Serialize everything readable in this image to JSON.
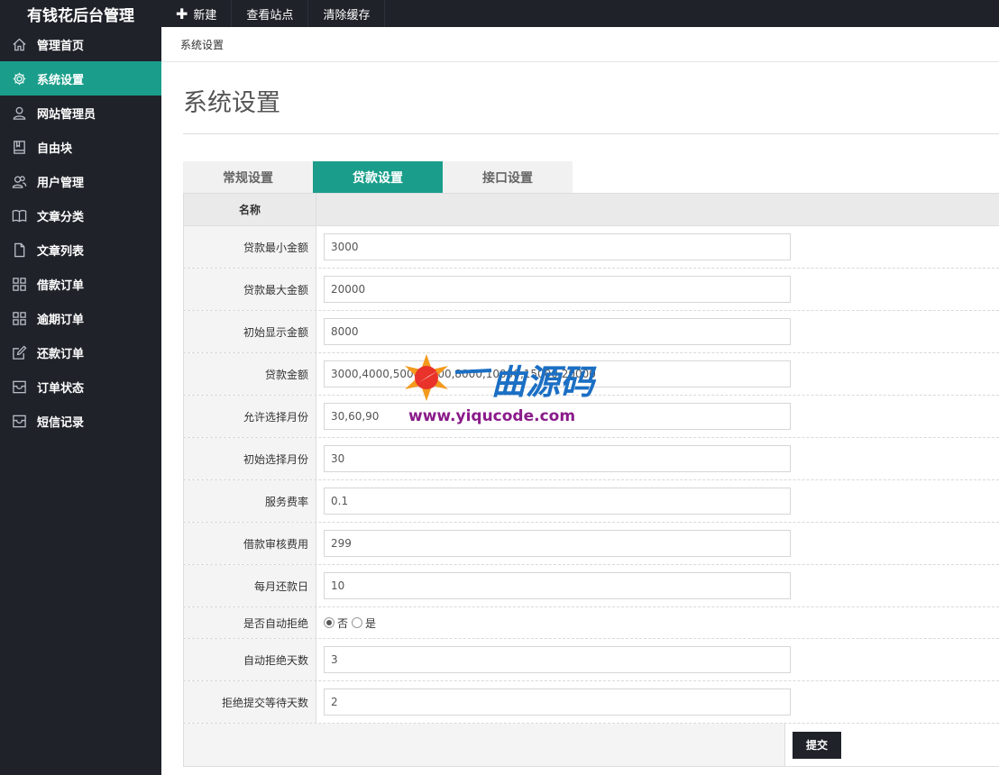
{
  "brand": {
    "title": "有钱花后台管理"
  },
  "topnav": {
    "new": "新建",
    "view_site": "查看站点",
    "clear_cache": "清除缓存"
  },
  "sidebar": {
    "items": [
      {
        "label": "管理首页",
        "icon": "home-icon"
      },
      {
        "label": "系统设置",
        "icon": "gear-icon",
        "active": true
      },
      {
        "label": "网站管理员",
        "icon": "user-icon"
      },
      {
        "label": "自由块",
        "icon": "book-icon"
      },
      {
        "label": "用户管理",
        "icon": "users-icon"
      },
      {
        "label": "文章分类",
        "icon": "open-book-icon"
      },
      {
        "label": "文章列表",
        "icon": "file-icon"
      },
      {
        "label": "借款订单",
        "icon": "grid-icon"
      },
      {
        "label": "逾期订单",
        "icon": "grid-icon"
      },
      {
        "label": "还款订单",
        "icon": "edit-icon"
      },
      {
        "label": "订单状态",
        "icon": "inbox-icon"
      },
      {
        "label": "短信记录",
        "icon": "inbox-icon"
      }
    ]
  },
  "breadcrumb": "系统设置",
  "page_title": "系统设置",
  "tabs": [
    {
      "label": "常规设置"
    },
    {
      "label": "贷款设置",
      "active": true
    },
    {
      "label": "接口设置"
    }
  ],
  "table": {
    "header_name": "名称",
    "rows": [
      {
        "label": "贷款最小金额",
        "value": "3000"
      },
      {
        "label": "贷款最大金额",
        "value": "20000"
      },
      {
        "label": "初始显示金额",
        "value": "8000"
      },
      {
        "label": "贷款金额",
        "value": "3000,4000,5000,6000,8000,10000,15000,20000"
      },
      {
        "label": "允许选择月份",
        "value": "30,60,90"
      },
      {
        "label": "初始选择月份",
        "value": "30"
      },
      {
        "label": "服务费率",
        "value": "0.1"
      },
      {
        "label": "借款审核费用",
        "value": "299"
      },
      {
        "label": "每月还款日",
        "value": "10"
      }
    ],
    "auto_reject": {
      "label": "是否自动拒绝",
      "option_no": "否",
      "option_yes": "是",
      "selected": "否"
    },
    "rows_after": [
      {
        "label": "自动拒绝天数",
        "value": "3"
      },
      {
        "label": "拒绝提交等待天数",
        "value": "2"
      }
    ],
    "submit_label": "提交"
  },
  "watermark": {
    "url": "www.yiqucode.com"
  },
  "colors": {
    "accent": "#1a9e8b",
    "sidebar_bg": "#1f2229"
  }
}
